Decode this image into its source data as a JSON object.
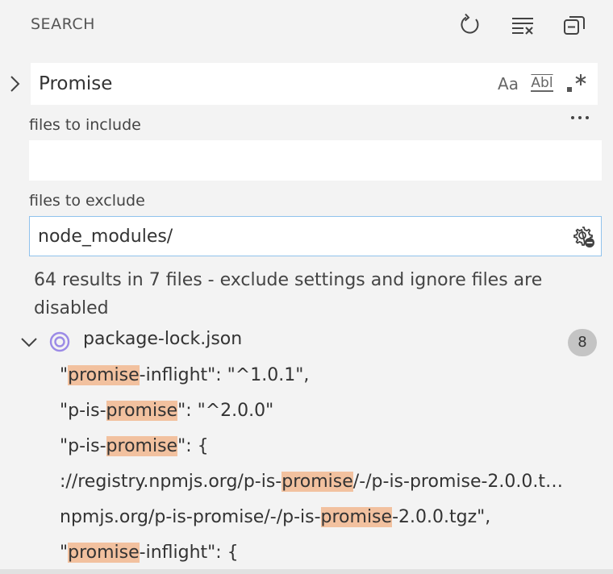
{
  "header": {
    "title": "SEARCH",
    "icons": [
      "refresh-icon",
      "clear-results-icon",
      "collapse-all-icon"
    ]
  },
  "search": {
    "value": "Promise",
    "options": {
      "match_case": "Aa",
      "whole_word": "Abl",
      "regex": ".*"
    }
  },
  "include": {
    "label": "files to include",
    "value": ""
  },
  "exclude": {
    "label": "files to exclude",
    "value": "node_modules/"
  },
  "results_message": "64 results in 7 files - exclude settings and ignore files are disabled",
  "file": {
    "name": "package-lock.json",
    "count": "8"
  },
  "matches": [
    {
      "before": "\"",
      "hit": "promise",
      "after": "-inflight\": \"^1.0.1\","
    },
    {
      "before": "\"p-is-",
      "hit": "promise",
      "after": "\": \"^2.0.0\""
    },
    {
      "before": "\"p-is-",
      "hit": "promise",
      "after": "\": {"
    },
    {
      "before": "://registry.npmjs.org/p-is-",
      "hit": "promise",
      "after": "/-/p-is-promise-2.0.0.t…"
    },
    {
      "before": "npmjs.org/p-is-promise/-/p-is-",
      "hit": "promise",
      "after": "-2.0.0.tgz\","
    },
    {
      "before": "\"",
      "hit": "promise",
      "after": "-inflight\": {"
    }
  ],
  "colors": {
    "background": "#f3f3f3",
    "highlight": "#f2c19f",
    "focus_border": "#90c2ec",
    "badge": "#c4c4c4"
  }
}
